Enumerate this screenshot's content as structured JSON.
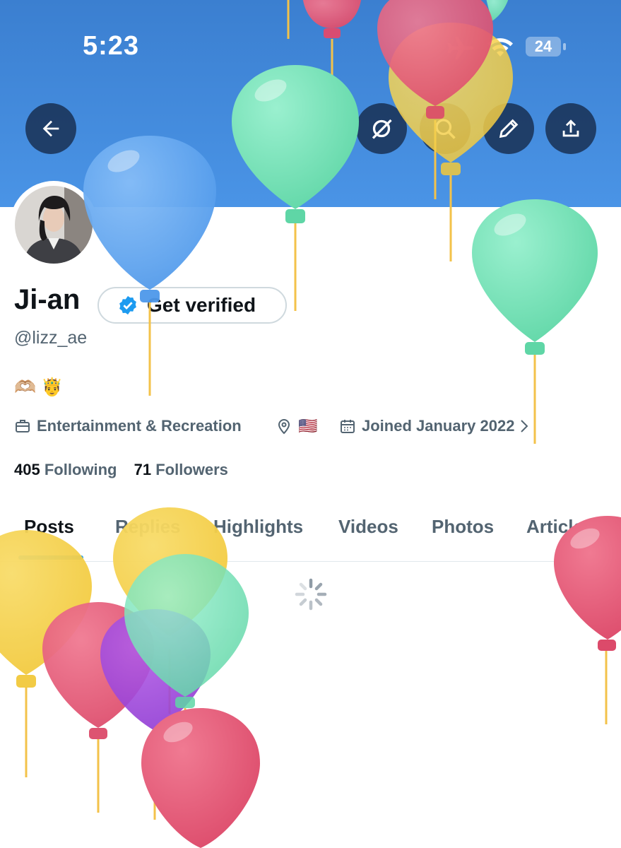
{
  "status_bar": {
    "time": "5:23",
    "battery": "24"
  },
  "profile": {
    "name": "Ji-an",
    "verify_label": "Get verified",
    "handle": "@lizz_ae",
    "bio": "🫶🏼 🤴",
    "category": "Entertainment & Recreation",
    "location": "🇺🇸",
    "joined": "Joined January 2022",
    "following_count": "405",
    "following_label": "Following",
    "followers_count": "71",
    "followers_label": "Followers"
  },
  "tabs": [
    {
      "label": "Posts"
    },
    {
      "label": "Replies"
    },
    {
      "label": "Highlights"
    },
    {
      "label": "Videos"
    },
    {
      "label": "Photos"
    },
    {
      "label": "Articles"
    }
  ],
  "colors": {
    "banner": "#4a94e6",
    "accent": "#1d9bf0",
    "text": "#0f1419",
    "muted": "#536471"
  },
  "icons": [
    "back-arrow-icon",
    "grok-icon",
    "search-icon",
    "edit-icon",
    "share-icon",
    "verified-badge-icon",
    "briefcase-icon",
    "location-icon",
    "calendar-icon",
    "chevron-right-icon",
    "loading-spinner-icon"
  ]
}
